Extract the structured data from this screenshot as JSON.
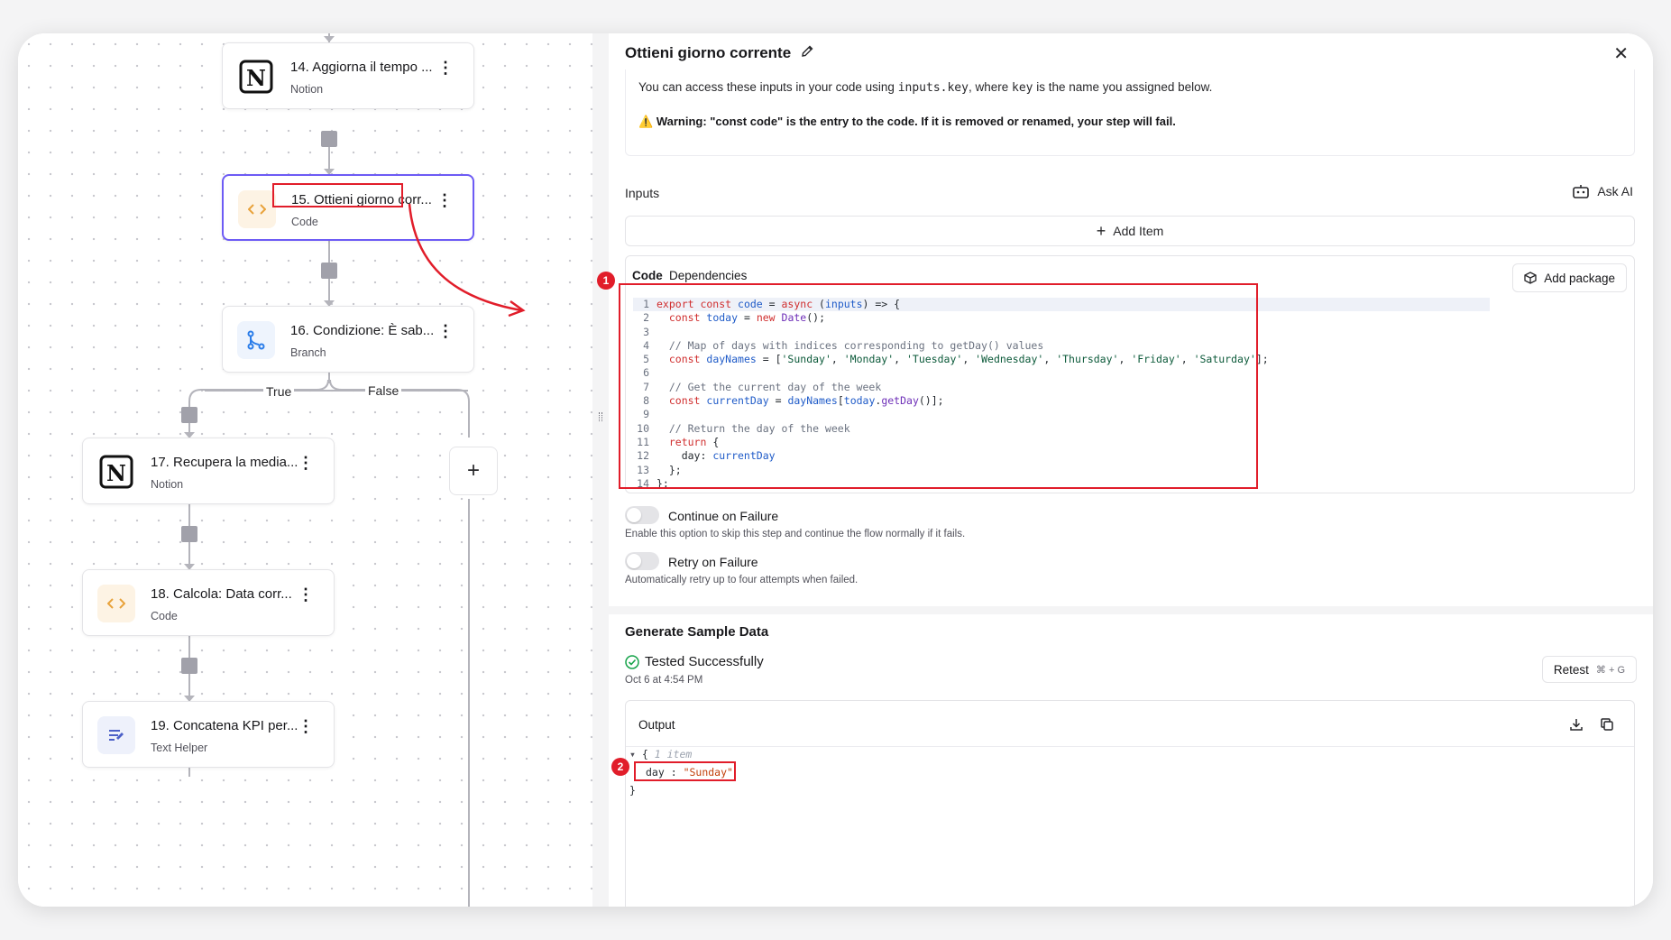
{
  "flow": {
    "nodes": [
      {
        "title": "14. Aggiorna il tempo ...",
        "subtitle": "Notion",
        "icon": "notion-icon"
      },
      {
        "title": "15. Ottieni giorno corr...",
        "subtitle": "Code",
        "icon": "code-icon"
      },
      {
        "title": "16. Condizione: È sab...",
        "subtitle": "Branch",
        "icon": "branch-icon"
      },
      {
        "title": "17. Recupera la media...",
        "subtitle": "Notion",
        "icon": "notion-icon"
      },
      {
        "title": "18. Calcola: Data corr...",
        "subtitle": "Code",
        "icon": "code-icon"
      },
      {
        "title": "19. Concatena KPI per...",
        "subtitle": "Text Helper",
        "icon": "text-helper-icon"
      }
    ],
    "branch_true": "True",
    "branch_false": "False",
    "add_step": "+"
  },
  "annotations": {
    "badge1": "1",
    "badge2": "2"
  },
  "panel": {
    "title": "Ottieni giorno corrente",
    "info_prefix": "You can access these inputs in your code using ",
    "info_code1": "inputs.key",
    "info_mid": ", where ",
    "info_code2": "key",
    "info_suffix": " is the name you assigned below.",
    "warning": "Warning: \"const code\" is the entry to the code. If it is removed or renamed, your step will fail.",
    "inputs_label": "Inputs",
    "ask_ai": "Ask AI",
    "add_item": "Add Item",
    "tab_code": "Code",
    "tab_dependencies": "Dependencies",
    "add_package": "Add package",
    "continue_label": "Continue on Failure",
    "continue_desc": "Enable this option to skip this step and continue the flow normally if it fails.",
    "retry_label": "Retry on Failure",
    "retry_desc": "Automatically retry up to four attempts when failed.",
    "generate_title": "Generate Sample Data",
    "tested": "Tested Successfully",
    "tested_date": "Oct 6 at 4:54 PM",
    "retest": "Retest",
    "retest_shortcut": "⌘ + G",
    "output_label": "Output",
    "json_items": "1 item",
    "json_key": "day",
    "json_value": "\"Sunday\""
  },
  "code_lines": [
    "export const code = async (inputs) => {",
    "  const today = new Date();",
    "",
    "  // Map of days with indices corresponding to getDay() values",
    "  const dayNames = ['Sunday', 'Monday', 'Tuesday', 'Wednesday', 'Thursday', 'Friday', 'Saturday'];",
    "",
    "  // Get the current day of the week",
    "  const currentDay = dayNames[today.getDay()];",
    "",
    "  // Return the day of the week",
    "  return {",
    "    day: currentDay",
    "  };",
    "};"
  ],
  "colors": {
    "accent": "#6d5bf5",
    "annotation": "#e11d2a",
    "success": "#16a34a",
    "code_icon": "#e8a23a",
    "branch_icon": "#2b7de9"
  }
}
